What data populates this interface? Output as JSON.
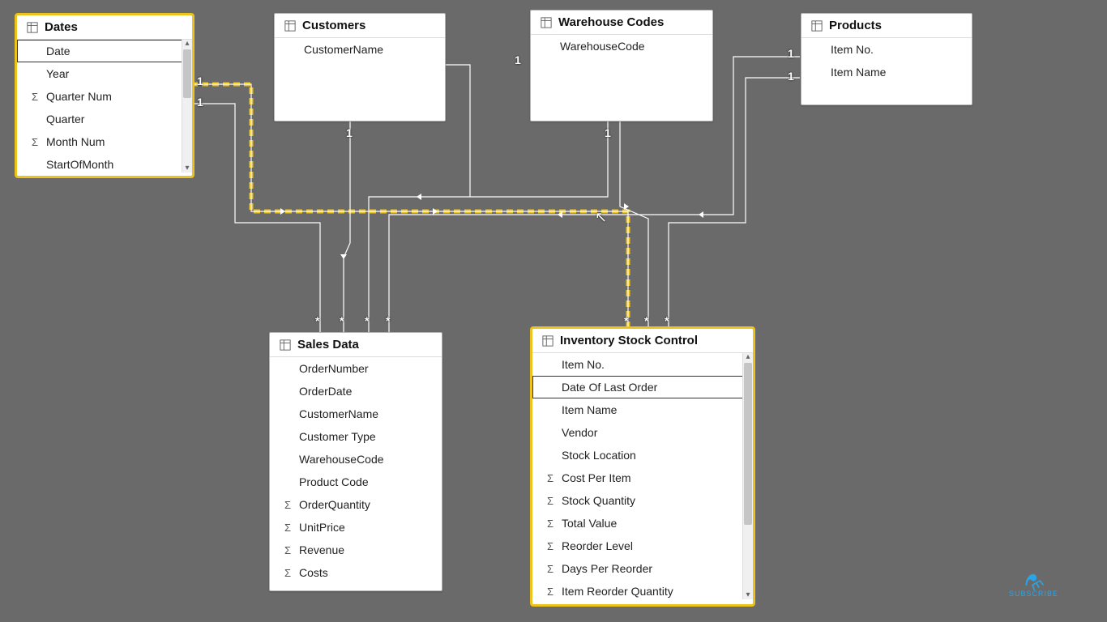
{
  "tables": {
    "dates": {
      "title": "Dates",
      "fields": [
        {
          "name": "Date",
          "agg": false,
          "selected": true
        },
        {
          "name": "Year",
          "agg": false
        },
        {
          "name": "Quarter Num",
          "agg": true
        },
        {
          "name": "Quarter",
          "agg": false
        },
        {
          "name": "Month Num",
          "agg": true
        },
        {
          "name": "StartOfMonth",
          "agg": false
        }
      ]
    },
    "customers": {
      "title": "Customers",
      "fields": [
        {
          "name": "CustomerName",
          "agg": false
        }
      ]
    },
    "warehouse": {
      "title": "Warehouse Codes",
      "fields": [
        {
          "name": "WarehouseCode",
          "agg": false
        }
      ]
    },
    "products": {
      "title": "Products",
      "fields": [
        {
          "name": "Item No.",
          "agg": false
        },
        {
          "name": "Item Name",
          "agg": false
        }
      ]
    },
    "sales": {
      "title": "Sales Data",
      "fields": [
        {
          "name": "OrderNumber",
          "agg": false
        },
        {
          "name": "OrderDate",
          "agg": false
        },
        {
          "name": "CustomerName",
          "agg": false
        },
        {
          "name": "Customer Type",
          "agg": false
        },
        {
          "name": "WarehouseCode",
          "agg": false
        },
        {
          "name": "Product Code",
          "agg": false
        },
        {
          "name": "OrderQuantity",
          "agg": true
        },
        {
          "name": "UnitPrice",
          "agg": true
        },
        {
          "name": "Revenue",
          "agg": true
        },
        {
          "name": "Costs",
          "agg": true
        }
      ]
    },
    "inventory": {
      "title": "Inventory Stock Control",
      "fields": [
        {
          "name": "Item No.",
          "agg": false
        },
        {
          "name": "Date Of Last Order",
          "agg": false,
          "selected": true
        },
        {
          "name": "Item Name",
          "agg": false
        },
        {
          "name": "Vendor",
          "agg": false
        },
        {
          "name": "Stock Location",
          "agg": false
        },
        {
          "name": "Cost Per Item",
          "agg": true
        },
        {
          "name": "Stock Quantity",
          "agg": true
        },
        {
          "name": "Total Value",
          "agg": true
        },
        {
          "name": "Reorder Level",
          "agg": true
        },
        {
          "name": "Days Per Reorder",
          "agg": true
        },
        {
          "name": "Item Reorder Quantity",
          "agg": true
        }
      ]
    }
  },
  "cardinality": {
    "dates_sales": "1",
    "dates_inv": "1",
    "customers_sales": "1",
    "warehouse_sales": "1",
    "warehouse_inv": "1",
    "products_sales": "1",
    "products_inv": "1",
    "many": "*"
  },
  "subscribe": "SUBSCRIBE"
}
